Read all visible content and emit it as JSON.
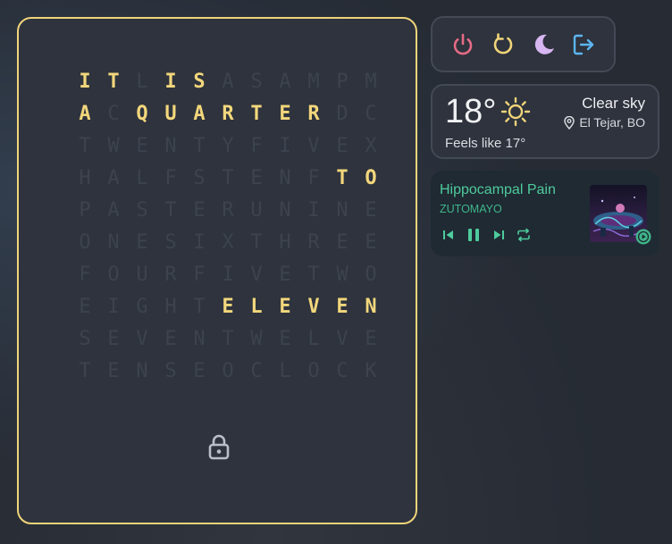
{
  "word_clock": {
    "rows": [
      "ITLISASAMPM",
      "ACQUARTERDC",
      "TWENTYFIVEX",
      "HALFSTENFTO",
      "PASTERUNINE",
      "ONESIXTHREE",
      "FOURFIVETWO",
      "EIGHTELEVEN",
      "SEVENTWELVE",
      "TENSEOCLOCK"
    ],
    "lit": [
      [
        0,
        0
      ],
      [
        0,
        1
      ],
      [
        0,
        3
      ],
      [
        0,
        4
      ],
      [
        1,
        0
      ],
      [
        1,
        2
      ],
      [
        1,
        3
      ],
      [
        1,
        4
      ],
      [
        1,
        5
      ],
      [
        1,
        6
      ],
      [
        1,
        7
      ],
      [
        1,
        8
      ],
      [
        3,
        9
      ],
      [
        3,
        10
      ],
      [
        7,
        5
      ],
      [
        7,
        6
      ],
      [
        7,
        7
      ],
      [
        7,
        8
      ],
      [
        7,
        9
      ],
      [
        7,
        10
      ]
    ],
    "lit_color": "#f3d77c",
    "dim_color": "#3d434e",
    "lock_icon": "lock-icon"
  },
  "power_menu": {
    "buttons": [
      {
        "icon": "power-icon",
        "color": "#e56b86"
      },
      {
        "icon": "restart-icon",
        "color": "#f0d47a"
      },
      {
        "icon": "moon-icon",
        "color": "#d7b6f2"
      },
      {
        "icon": "logout-icon",
        "color": "#5cb6f0"
      }
    ]
  },
  "weather": {
    "temperature": "18°",
    "condition": "Clear sky",
    "location": "El Tejar, BO",
    "feels_like": "Feels like 17°",
    "icon": "sun-icon",
    "location_icon": "location-pin-icon"
  },
  "media": {
    "title": "Hippocampal Pain",
    "artist": "ZUTOMAYO",
    "accent": "#4ecb9c",
    "controls": [
      "previous-icon",
      "pause-icon",
      "next-icon",
      "repeat-icon"
    ],
    "player_badge_icon": "play-badge-icon"
  }
}
